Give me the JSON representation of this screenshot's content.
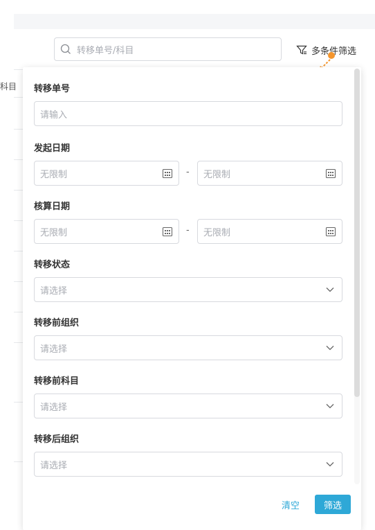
{
  "search": {
    "placeholder": "转移单号/科目"
  },
  "toolbar": {
    "multi_filter_label": "多条件筛选"
  },
  "background": {
    "header_fragment": "科目"
  },
  "filter_panel": {
    "transfer_no": {
      "label": "转移单号",
      "placeholder": "请输入"
    },
    "start_date": {
      "label": "发起日期",
      "from_placeholder": "无限制",
      "to_placeholder": "无限制",
      "separator": "-"
    },
    "accounting_date": {
      "label": "核算日期",
      "from_placeholder": "无限制",
      "to_placeholder": "无限制",
      "separator": "-"
    },
    "transfer_status": {
      "label": "转移状态",
      "placeholder": "请选择"
    },
    "org_before": {
      "label": "转移前组织",
      "placeholder": "请选择"
    },
    "subject_before": {
      "label": "转移前科目",
      "placeholder": "请选择"
    },
    "org_after": {
      "label": "转移后组织",
      "placeholder": "请选择"
    },
    "buttons": {
      "clear": "清空",
      "filter": "筛选"
    }
  },
  "colors": {
    "accent": "#2ea8d7",
    "annotation": "#f5962d",
    "border": "#d7d9de",
    "placeholder": "#a9acb3"
  }
}
